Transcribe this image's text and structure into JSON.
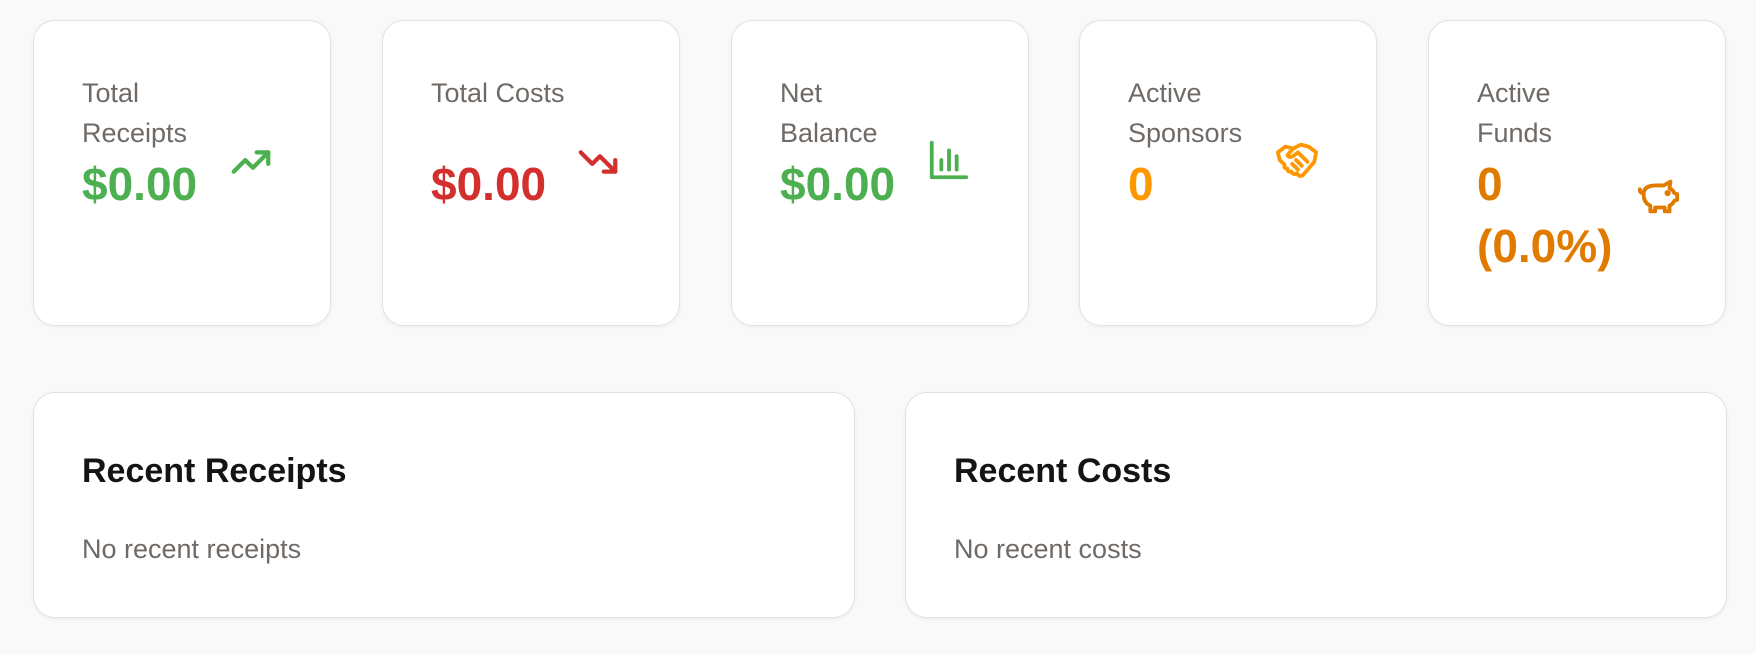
{
  "stats": [
    {
      "label": "Total Receipts",
      "value": "$0.00",
      "icon": "trending-up-icon",
      "color": "#4caf50"
    },
    {
      "label": "Total Costs",
      "value": "$0.00",
      "icon": "trending-down-icon",
      "color": "#d32f2f"
    },
    {
      "label": "Net Balance",
      "value": "$0.00",
      "icon": "bar-chart-icon",
      "color": "#4caf50"
    },
    {
      "label": "Active Sponsors",
      "value": "0",
      "icon": "handshake-icon",
      "color": "#ff9800"
    },
    {
      "label": "Active Funds",
      "value": "0 (0.0%)",
      "icon": "piggy-bank-icon",
      "color": "#e07b00"
    }
  ],
  "recent_receipts": {
    "title": "Recent Receipts",
    "empty_text": "No recent receipts"
  },
  "recent_costs": {
    "title": "Recent Costs",
    "empty_text": "No recent costs"
  }
}
